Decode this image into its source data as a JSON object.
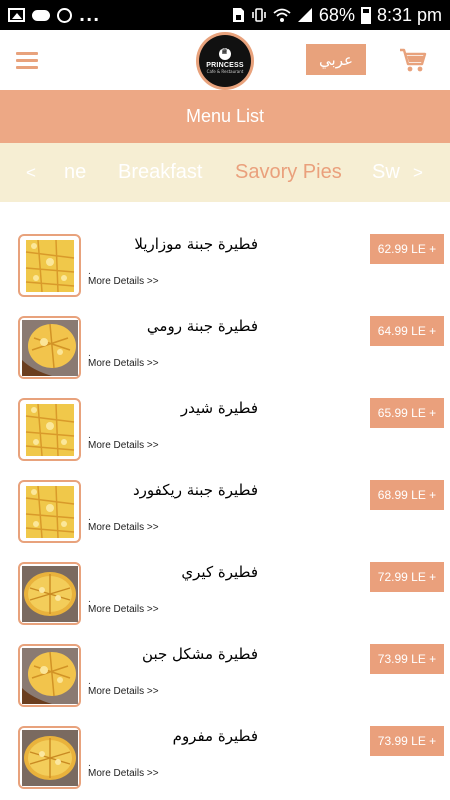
{
  "status_bar": {
    "battery": "68%",
    "time": "8:31 pm",
    "icons": [
      "image-icon",
      "cloud-icon",
      "sync-icon",
      "more-dots",
      "sim-icon",
      "vibrate-icon",
      "wifi-icon",
      "signal-icon",
      "battery-icon"
    ]
  },
  "header": {
    "logo_text": "PRINCESS",
    "logo_sub": "Cafe & Restaurant",
    "language_button": "عربي"
  },
  "menu_title": "Menu List",
  "categories": {
    "prev": "<",
    "next": ">",
    "items": [
      "ne",
      "Breakfast",
      "Savory Pies",
      "Sw"
    ],
    "active": "Savory Pies"
  },
  "colors": {
    "accent": "#eaa07c",
    "title_bar": "#eda885",
    "category_bar": "#f6eed3"
  },
  "items": [
    {
      "name": "فطيرة جبنة موزاريلا",
      "dot": ".",
      "details": "More Details >>",
      "price": "62.99 LE +",
      "image": "pie-square"
    },
    {
      "name": "فطيرة جبنة رومي",
      "dot": ".",
      "details": "More Details >>",
      "price": "64.99 LE +",
      "image": "pie-board"
    },
    {
      "name": "فطيرة شيدر",
      "dot": ".",
      "details": "More Details >>",
      "price": "65.99 LE +",
      "image": "pie-square"
    },
    {
      "name": "فطيرة جبنة ريكفورد",
      "dot": ".",
      "details": "More Details >>",
      "price": "68.99 LE +",
      "image": "pie-square"
    },
    {
      "name": "فطيرة كيري",
      "dot": ".",
      "details": "More Details >>",
      "price": "72.99 LE +",
      "image": "pie-round"
    },
    {
      "name": "فطيرة مشكل جبن",
      "dot": ".",
      "details": "More Details >>",
      "price": "73.99 LE +",
      "image": "pie-board"
    },
    {
      "name": "فطيرة مفروم",
      "dot": ".",
      "details": "More Details >>",
      "price": "73.99 LE +",
      "image": "pie-round"
    }
  ]
}
